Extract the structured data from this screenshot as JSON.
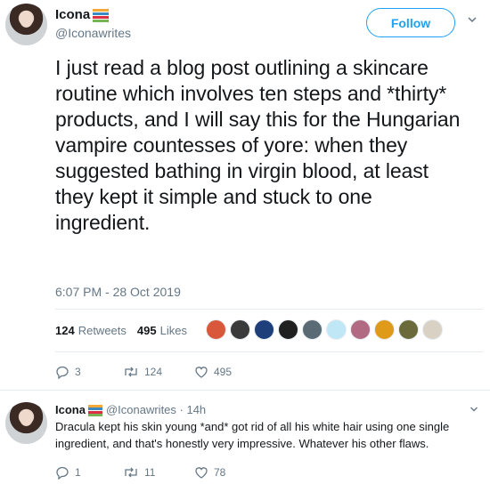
{
  "author": {
    "display_name": "Icona",
    "handle": "@Iconawrites"
  },
  "follow_label": "Follow",
  "tweet": {
    "text": "I just read a blog post outlining a skincare routine which involves ten steps and *thirty* products, and I will say this for the Hungarian vampire countesses of yore: when they suggested bathing in virgin blood, at least they kept it simple and stuck to one ingredient.",
    "timestamp": "6:07 PM - 28 Oct 2019",
    "retweets_count": "124",
    "retweets_label": "Retweets",
    "likes_count": "495",
    "likes_label": "Likes",
    "reply_count": "3",
    "retweet_action_count": "124",
    "like_action_count": "495"
  },
  "liker_colors": [
    "#d9583b",
    "#3a3a3a",
    "#1f3f7a",
    "#202020",
    "#5b6b76",
    "#bfe7f5",
    "#b26a83",
    "#e09a1a",
    "#6b6a3a",
    "#d9d2c4"
  ],
  "reply": {
    "display_name": "Icona",
    "handle_time": "@Iconawrites · 14h",
    "text": "Dracula kept his skin young *and* got rid of all his white hair using one single ingredient, and that's honestly very impressive. Whatever his other flaws.",
    "reply_count": "1",
    "retweet_count": "11",
    "like_count": "78"
  },
  "colors": {
    "accent": "#1da1f2",
    "secondary_text": "#657786",
    "divider": "#e6ecf0"
  }
}
